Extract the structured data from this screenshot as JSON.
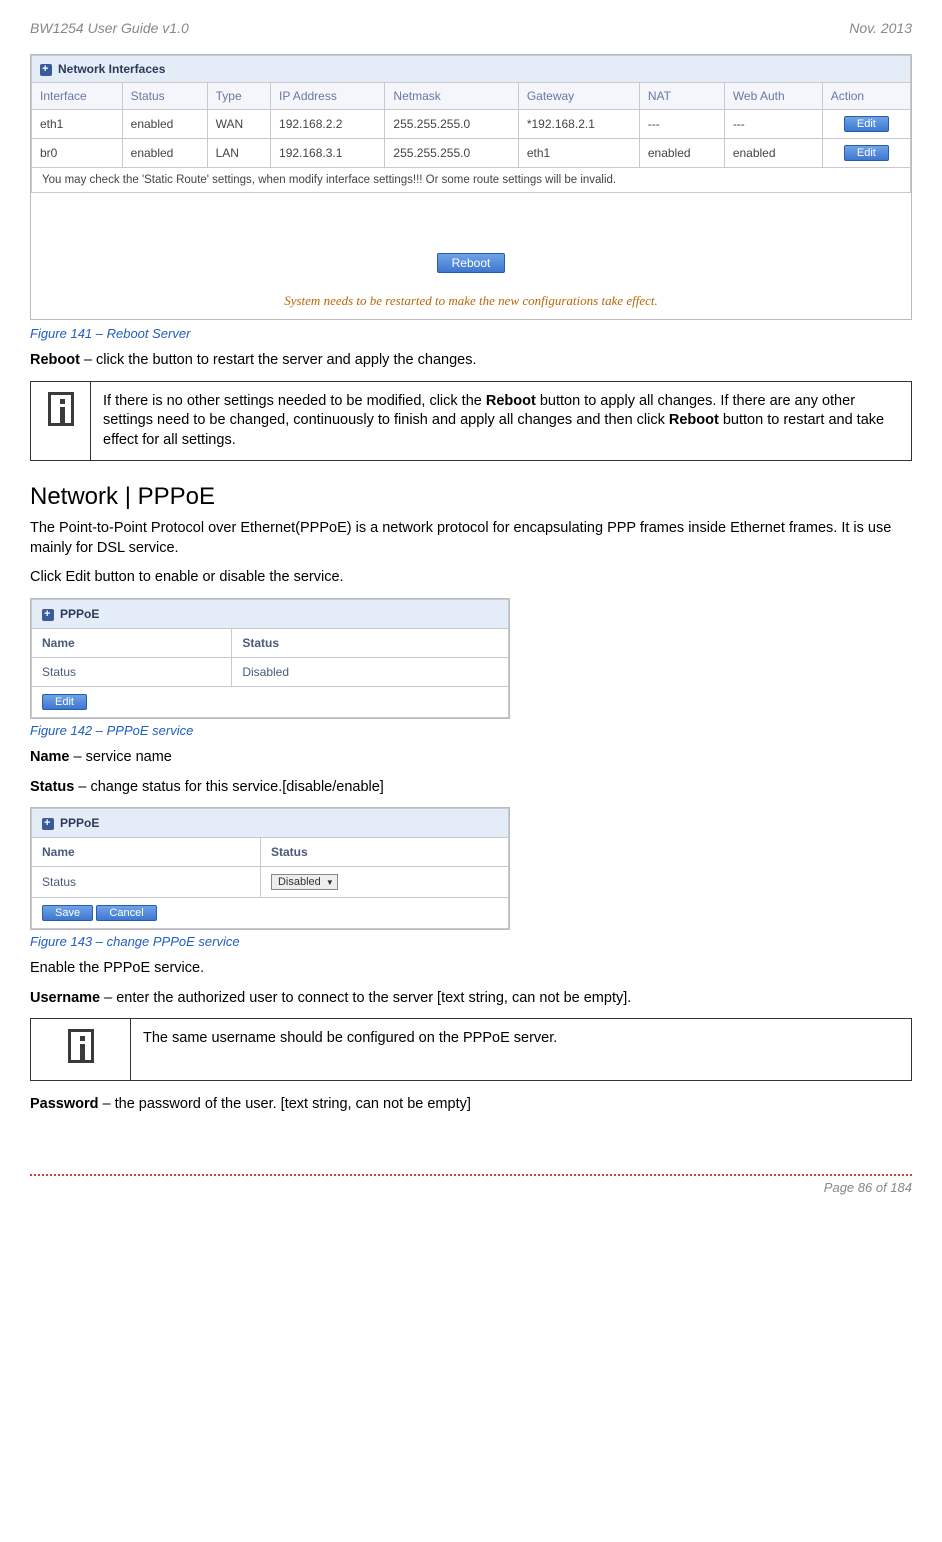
{
  "header": {
    "left": "BW1254 User Guide v1.0",
    "right": "Nov.  2013"
  },
  "fig141": {
    "panel_title": "Network Interfaces",
    "cols": [
      "Interface",
      "Status",
      "Type",
      "IP Address",
      "Netmask",
      "Gateway",
      "NAT",
      "Web Auth",
      "Action"
    ],
    "rows": [
      {
        "iface": "eth1",
        "status": "enabled",
        "type": "WAN",
        "ip": "192.168.2.2",
        "mask": "255.255.255.0",
        "gw": "*192.168.2.1",
        "nat": "---",
        "auth": "---",
        "action": "Edit"
      },
      {
        "iface": "br0",
        "status": "enabled",
        "type": "LAN",
        "ip": "192.168.3.1",
        "mask": "255.255.255.0",
        "gw": "eth1",
        "nat": "enabled",
        "auth": "enabled",
        "action": "Edit"
      }
    ],
    "note": "You may check the 'Static Route' settings, when modify interface settings!!! Or some route settings will be invalid.",
    "reboot_btn": "Reboot",
    "sys_msg": "System needs to be restarted to make the new configurations take effect.",
    "caption": "Figure 141 – Reboot Server"
  },
  "reboot_line": {
    "label": "Reboot",
    "text": " – click the button to restart the server and apply the changes."
  },
  "info1": {
    "t1": "If there is no other settings needed to be modified, click the ",
    "b1": "Reboot",
    "t2": " button to apply all changes. If there are any other settings need to be changed, continuously to finish and apply all changes and then click ",
    "b2": "Reboot",
    "t3": " button to restart and take effect  for all settings."
  },
  "section_title": "Network | PPPoE",
  "pppoe_intro": "The Point-to-Point Protocol over Ethernet(PPPoE) is a network protocol for encapsulating PPP frames inside Ethernet frames. It is use mainly for DSL service.",
  "pppoe_click": "Click Edit button to enable or disable the service.",
  "fig142": {
    "panel_title": "PPPoE",
    "col_name": "Name",
    "col_status": "Status",
    "row_name": "Status",
    "row_status": "Disabled",
    "edit_btn": "Edit",
    "caption": "Figure 142 – PPPoE service"
  },
  "name_line": {
    "label": "Name",
    "text": " – service name"
  },
  "status_line": {
    "label": "Status",
    "text": " – change status for this service.[disable/enable]"
  },
  "fig143": {
    "panel_title": "PPPoE",
    "col_name": "Name",
    "col_status": "Status",
    "row_name": "Status",
    "select_val": "Disabled",
    "save_btn": "Save",
    "cancel_btn": "Cancel",
    "caption": "Figure 143 – change PPPoE service"
  },
  "enable_line": "Enable the PPPoE service.",
  "user_line": {
    "label": "Username",
    "text": " – enter the authorized user to connect to the server [text string, can not be empty]."
  },
  "info2": "The same username should be configured on the PPPoE server.",
  "pass_line": {
    "label": "Password",
    "text": " – the password of the user. [text string, can not be empty]"
  },
  "footer": "Page 86 of 184"
}
